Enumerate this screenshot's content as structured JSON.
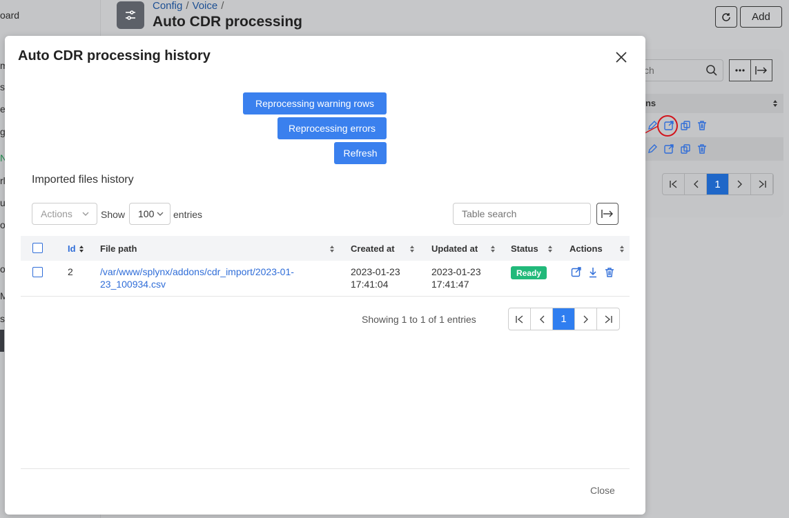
{
  "sidebar": {
    "items": [
      {
        "label": "oard",
        "green": false
      },
      {
        "label": "m",
        "green": false
      },
      {
        "label": "s",
        "green": false
      },
      {
        "label": "e",
        "green": false
      },
      {
        "label": "g",
        "green": false
      },
      {
        "label": "N",
        "green": true
      },
      {
        "label": "rl",
        "green": false
      },
      {
        "label": "u",
        "green": false
      },
      {
        "label": "o",
        "green": false
      },
      {
        "label": "ol",
        "green": false
      },
      {
        "label": "M",
        "green": false
      },
      {
        "label": "s",
        "green": false
      }
    ]
  },
  "header": {
    "breadcrumb": [
      "Config",
      "Voice"
    ],
    "breadcrumb_sep": "/",
    "title": "Auto CDR processing",
    "add_label": "Add"
  },
  "background_table": {
    "search_placeholder": "ch",
    "actions_header": "ons",
    "pager": [
      "1"
    ]
  },
  "modal": {
    "title": "Auto CDR processing history",
    "buttons": {
      "reprocess_warning": "Reprocessing warning rows",
      "reprocess_errors": "Reprocessing errors",
      "refresh": "Refresh"
    },
    "section_title": "Imported files history",
    "toolbar": {
      "actions_placeholder": "Actions",
      "show_label": "Show",
      "entries_value": "100",
      "entries_label": "entries",
      "search_placeholder": "Table search"
    },
    "table": {
      "columns": [
        "Id",
        "File path",
        "Created at",
        "Updated at",
        "Status",
        "Actions"
      ],
      "rows": [
        {
          "id": "2",
          "file_path_line1": "/var/www/splynx/addons/cdr_import/2023-01-",
          "file_path_line2": "23_100934.csv",
          "created_date": "2023-01-23",
          "created_time": "17:41:04",
          "updated_date": "2023-01-23",
          "updated_time": "17:41:47",
          "status": "Ready"
        }
      ]
    },
    "pagination": {
      "showing": "Showing 1 to 1 of 1 entries",
      "current_page": "1"
    },
    "close_label": "Close"
  },
  "colors": {
    "primary": "#3a80ee",
    "link": "#2f6dd8",
    "status_ready": "#21b97a",
    "annotation": "#d2141c"
  }
}
